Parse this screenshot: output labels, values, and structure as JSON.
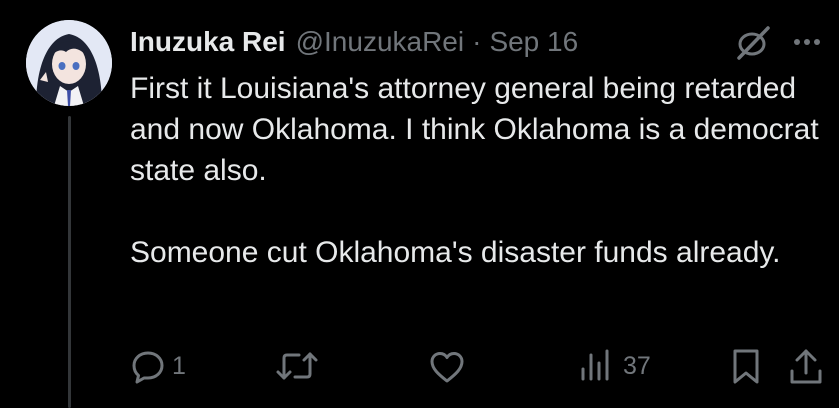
{
  "tweet": {
    "display_name": "Inuzuka Rei",
    "handle": "@InuzukaRei",
    "separator": "·",
    "date": "Sep 16",
    "paragraphs": [
      "First it Louisiana's attorney general being retarded and now Oklahoma. I think Oklahoma is a democrat state also.",
      "Someone cut Oklahoma's disaster funds already."
    ]
  },
  "actions": {
    "reply_count": "1",
    "views_count": "37"
  },
  "icons": {
    "avatar": "avatar",
    "grok": "grok-icon",
    "more": "more-icon",
    "reply": "reply-icon",
    "retweet": "retweet-icon",
    "like": "like-icon",
    "views": "views-icon",
    "bookmark": "bookmark-icon",
    "share": "share-icon"
  },
  "colors": {
    "background": "#000000",
    "text": "#e7e9ea",
    "muted": "#71767b",
    "thread_line": "#333639"
  }
}
